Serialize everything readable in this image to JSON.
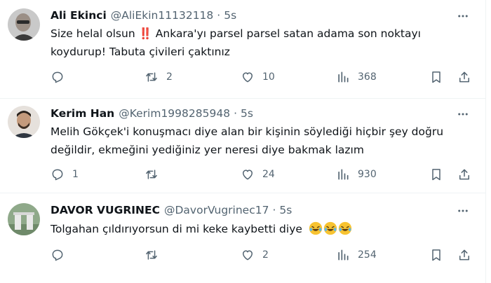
{
  "tweets": [
    {
      "name": "Ali Ekinci",
      "handle": "@AliEkin11132118",
      "separator": "·",
      "time": "5s",
      "text": "Size helal olsun ‼️ Ankara'yı parsel parsel satan adama son noktayı koydurup! Tabuta çivileri çaktınız",
      "replies": "",
      "retweets": "2",
      "likes": "10",
      "views": "368"
    },
    {
      "name": "Kerim Han",
      "handle": "@Kerim1998285948",
      "separator": "·",
      "time": "5s",
      "text": "Melih Gökçek'i konuşmacı diye alan bir kişinin söylediği hiçbir şey doğru değildir, ekmeğini yediğiniz yer neresi diye bakmak lazım",
      "replies": "1",
      "retweets": "",
      "likes": "24",
      "views": "930"
    },
    {
      "name": "DAVOR VUGRINEC",
      "handle": "@DavorVugrinec17",
      "separator": "·",
      "time": "5s",
      "text": "Tolgahan çıldırıyorsun di mi keke kaybetti diye",
      "emoji": "🤣🤣🤣",
      "replies": "",
      "retweets": "",
      "likes": "2",
      "views": "254"
    }
  ],
  "colors": {
    "text": "#0f1419",
    "secondary": "#536471",
    "divider": "#eff3f4",
    "alert_red": "#e0245e"
  },
  "icons": [
    "more-icon",
    "reply-icon",
    "retweet-icon",
    "like-icon",
    "views-icon",
    "bookmark-icon",
    "share-icon",
    "laughing-emoji-icon"
  ]
}
